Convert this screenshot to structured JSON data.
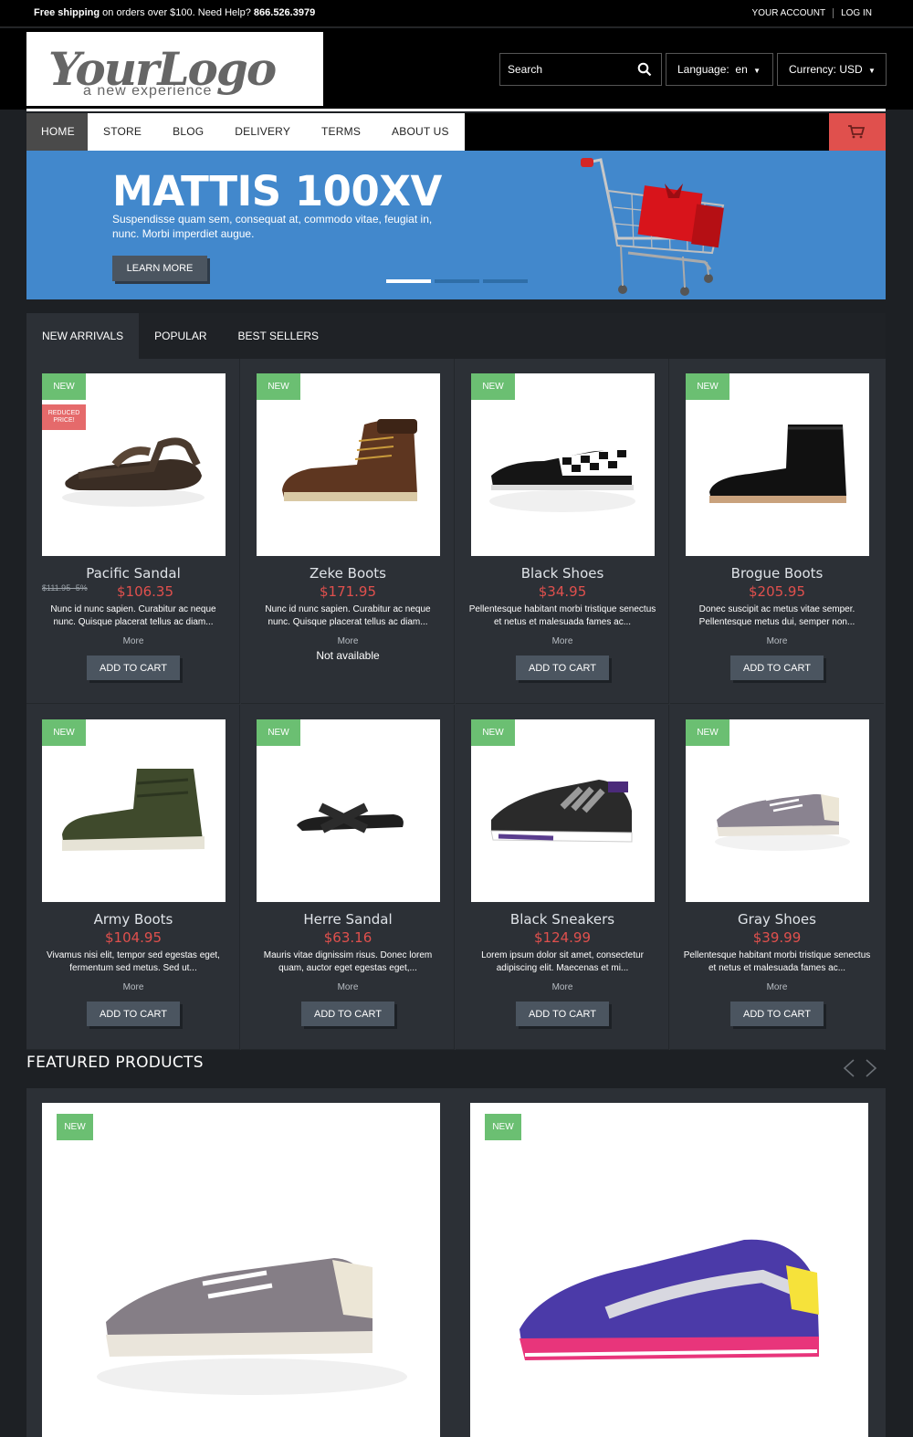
{
  "topbar": {
    "shipping_bold": "Free shipping",
    "shipping_rest": " on orders over $100. Need Help? ",
    "phone": "866.526.3979",
    "account": "YOUR ACCOUNT",
    "login": "LOG IN"
  },
  "header": {
    "logo_main": "YourLogo",
    "logo_tag": "a new experience",
    "search_placeholder": "Search",
    "language_label": "Language:",
    "language_value": "en",
    "currency_label": "Currency:",
    "currency_value": "USD"
  },
  "nav": {
    "items": [
      "HOME",
      "STORE",
      "BLOG",
      "DELIVERY",
      "TERMS",
      "ABOUT US"
    ]
  },
  "hero": {
    "title": "MATTIS 100XV",
    "subtitle": "Suspendisse quam sem, consequat at, commodo vitae, feugiat in, nunc. Morbi imperdiet augue.",
    "button": "LEARN MORE",
    "slides": 3,
    "active_slide": 1
  },
  "tabs": [
    "NEW ARRIVALS",
    "POPULAR",
    "BEST SELLERS"
  ],
  "products": [
    {
      "badge": "NEW",
      "reduced": "REDUCED PRICE!",
      "name": "Pacific Sandal",
      "old_price": "$111.95 -5%",
      "price": "$106.35",
      "desc": "Nunc id nunc sapien. Curabitur ac neque nunc. Quisque placerat tellus ac diam...",
      "more": "More",
      "action": "ADD TO CART",
      "shoe": "sandal-brown"
    },
    {
      "badge": "NEW",
      "name": "Zeke Boots",
      "price": "$171.95",
      "desc": "Nunc id nunc sapien. Curabitur ac neque nunc. Quisque placerat tellus ac diam...",
      "more": "More",
      "status": "Not available",
      "shoe": "boot-brown"
    },
    {
      "badge": "NEW",
      "name": "Black Shoes",
      "price": "$34.95",
      "desc": "Pellentesque habitant morbi tristique senectus et netus et malesuada fames ac...",
      "more": "More",
      "action": "ADD TO CART",
      "shoe": "shoe-checker"
    },
    {
      "badge": "NEW",
      "name": "Brogue Boots",
      "price": "$205.95",
      "desc": "Donec suscipit ac metus vitae semper. Pellentesque metus dui, semper non...",
      "more": "More",
      "action": "ADD TO CART",
      "shoe": "boot-black"
    },
    {
      "badge": "NEW",
      "name": "Army Boots",
      "price": "$104.95",
      "desc": "Vivamus nisi elit, tempor sed egestas eget, fermentum sed metus. Sed ut...",
      "more": "More",
      "action": "ADD TO CART",
      "shoe": "hightop-green"
    },
    {
      "badge": "NEW",
      "name": "Herre Sandal",
      "price": "$63.16",
      "desc": "Mauris vitae dignissim risus. Donec lorem quam, auctor eget egestas eget,...",
      "more": "More",
      "action": "ADD TO CART",
      "shoe": "slide-black"
    },
    {
      "badge": "NEW",
      "name": "Black Sneakers",
      "price": "$124.99",
      "desc": "Lorem ipsum dolor sit amet, consectetur adipiscing elit. Maecenas et mi...",
      "more": "More",
      "action": "ADD TO CART",
      "shoe": "sneaker-grey"
    },
    {
      "badge": "NEW",
      "name": "Gray Shoes",
      "price": "$39.99",
      "desc": "Pellentesque habitant morbi tristique senectus et netus et malesuada fames ac...",
      "more": "More",
      "action": "ADD TO CART",
      "shoe": "sneaker-light"
    }
  ],
  "featured": {
    "title": "FEATURED PRODUCTS",
    "items": [
      {
        "badge": "NEW",
        "shoe": "gray-shoe-large"
      },
      {
        "badge": "NEW",
        "shoe": "purple-runner-large"
      }
    ]
  },
  "colors": {
    "accent_red": "#e0504d",
    "hero_blue": "#4288cc",
    "badge_green": "#6bbf72",
    "panel": "#2c3036"
  }
}
